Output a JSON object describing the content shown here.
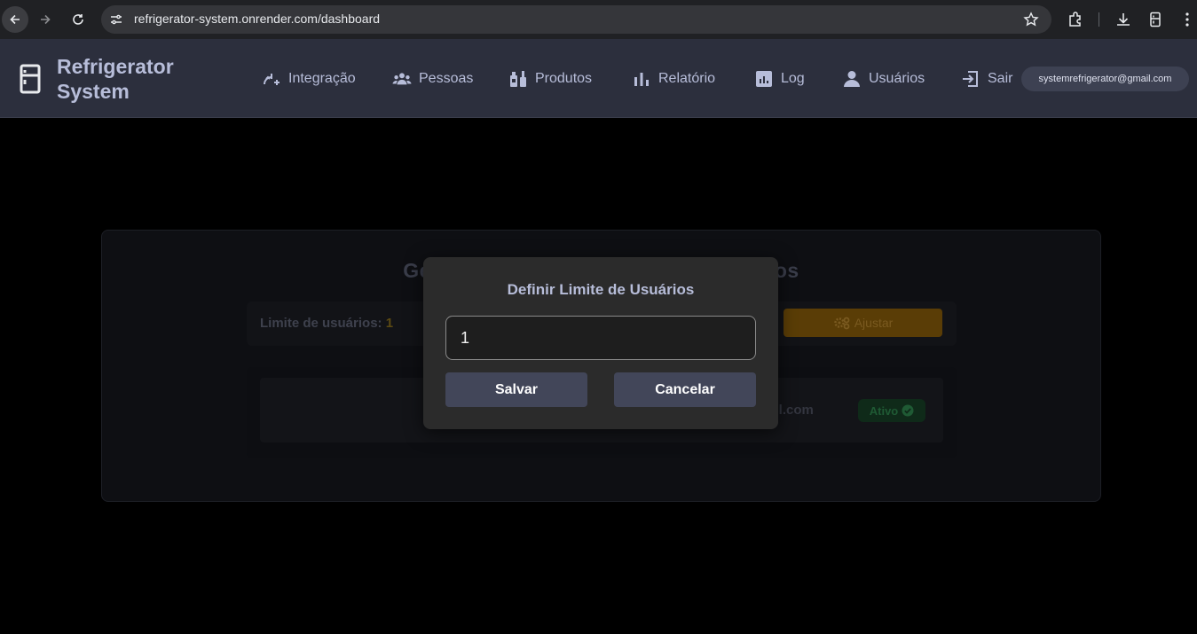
{
  "browser": {
    "url": "refrigerator-system.onrender.com/dashboard",
    "icons": [
      "back-icon",
      "forward-icon",
      "reload-icon",
      "site-info-icon",
      "bookmark-star-icon",
      "extensions-icon",
      "download-icon",
      "device-icon",
      "menu-dots-icon"
    ]
  },
  "app": {
    "brand_line1": "Refrigerator",
    "brand_line2": "System",
    "nav": [
      {
        "label": "Integração",
        "icon": "integration-icon"
      },
      {
        "label": "Pessoas",
        "icon": "people-icon"
      },
      {
        "label": "Produtos",
        "icon": "products-icon"
      },
      {
        "label": "Relatório",
        "icon": "report-icon"
      },
      {
        "label": "Log",
        "icon": "log-icon"
      },
      {
        "label": "Usuários",
        "icon": "user-icon"
      },
      {
        "label": "Sair",
        "icon": "logout-icon"
      }
    ],
    "user_email": "systemrefrigerator@gmail.com"
  },
  "card": {
    "title_left": "Ge",
    "title_right": "ios",
    "limit_label": "Limite de usuários: ",
    "limit_value": "1",
    "adjust_label": "Ajustar",
    "row_email_fragment": "nail.com",
    "status_label": "Ativo"
  },
  "modal": {
    "title": "Definir Limite de Usuários",
    "input_value": "1",
    "save_label": "Salvar",
    "cancel_label": "Cancelar"
  },
  "colors": {
    "header_bg": "#2c2f3d",
    "accent_text": "#b7bdd9",
    "modal_bg": "#2b2b2b",
    "button_bg": "#424659",
    "adjust_bg": "#5a3d06",
    "status_bg": "#0f2a19"
  }
}
